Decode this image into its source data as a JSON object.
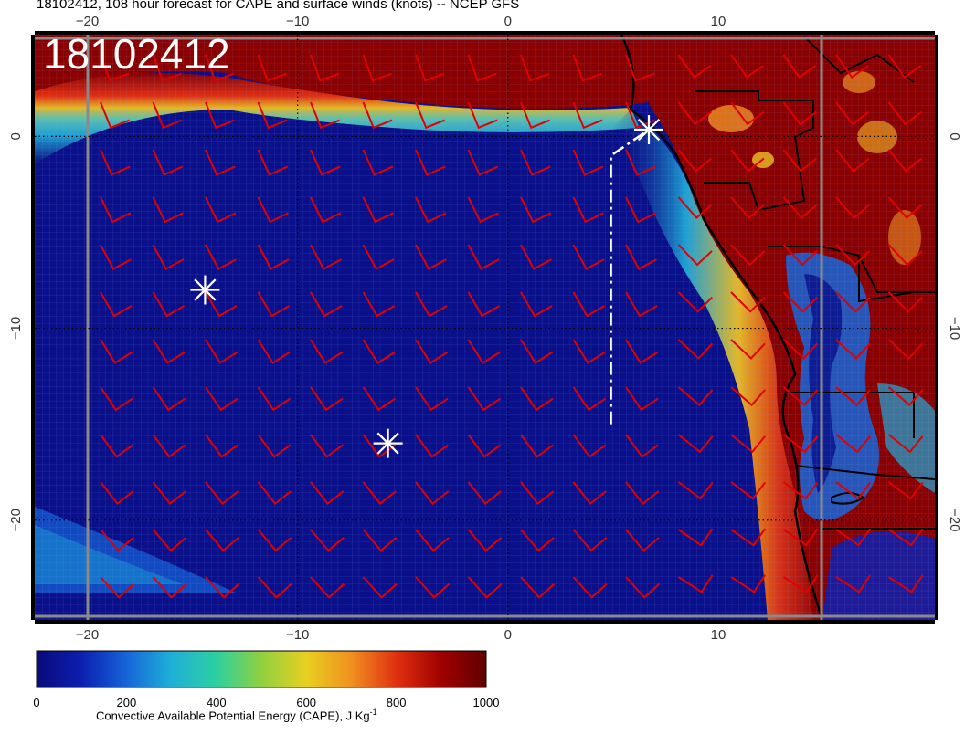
{
  "header": {
    "title": "18102412, 108 hour forecast for CAPE and surface winds (knots) -- NCEP GFS",
    "stamp": "18102412"
  },
  "map": {
    "lon_range": [
      -22.5,
      20.3
    ],
    "lat_range": [
      -25.2,
      5.3
    ],
    "projection": "equirectangular",
    "x_tick_labels_top": [
      "−20",
      "−10",
      "0",
      "10"
    ],
    "x_tick_labels_bottom": [
      "−20",
      "−10",
      "0",
      "10"
    ],
    "y_tick_labels_left": [
      "0",
      "−10",
      "−20"
    ],
    "y_tick_labels_right": [
      "0",
      "−10",
      "−20"
    ],
    "markers": [
      {
        "type": "asterisk",
        "lon": -14.4,
        "lat": -8.0,
        "color": "#ffffff"
      },
      {
        "type": "asterisk",
        "lon": -5.7,
        "lat": -16.0,
        "color": "#ffffff"
      },
      {
        "type": "asterisk",
        "lon": 6.7,
        "lat": 0.35,
        "color": "#ffffff"
      }
    ],
    "track": {
      "style": "dashed",
      "color": "#ffffff",
      "points": [
        [
          4.9,
          -15.0
        ],
        [
          4.9,
          -1.0
        ],
        [
          6.7,
          0.35
        ]
      ]
    },
    "wind_barb_color": "#e00000",
    "coast_color": "#000000"
  },
  "colorbar": {
    "min": 0,
    "max": 1000,
    "tick_labels": [
      "0",
      "200",
      "400",
      "600",
      "800",
      "1000"
    ],
    "label": "Convective Available Potential Energy (CAPE), J Kg",
    "label_superscript": "-1",
    "colors": [
      "#0a0a7a",
      "#0c1fb0",
      "#1565d8",
      "#1fb0d8",
      "#2cd0a0",
      "#90d040",
      "#e8d020",
      "#f09020",
      "#e03010",
      "#a00000",
      "#600000"
    ]
  }
}
